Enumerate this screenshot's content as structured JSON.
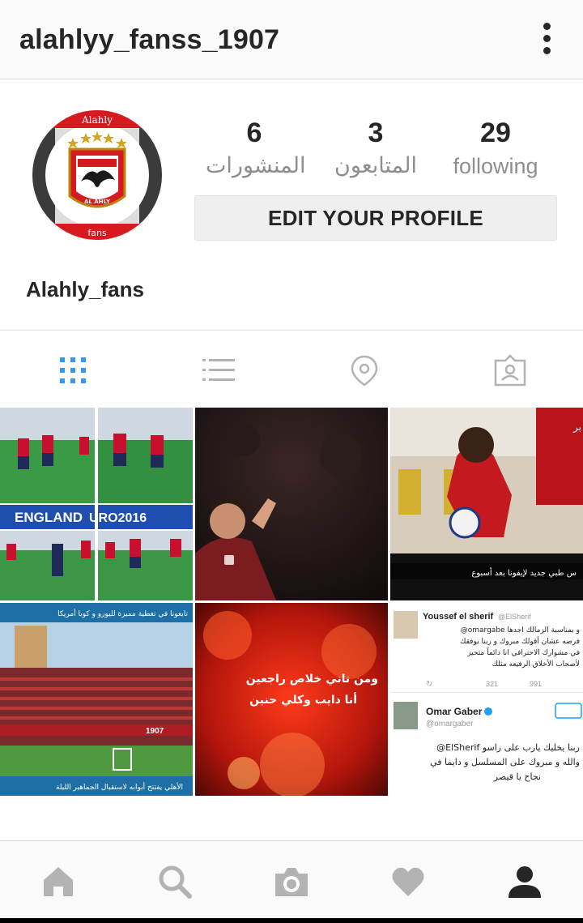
{
  "header": {
    "username": "alahlyy_fanss_1907",
    "menu_icon": "more-vertical-icon"
  },
  "profile": {
    "avatar_badge": {
      "top_text": "Alahly",
      "name_en": "AL AHLY",
      "bottom_text": "fans"
    },
    "stats": [
      {
        "value": "6",
        "label": "المنشورات"
      },
      {
        "value": "3",
        "label": "المتابعون"
      },
      {
        "value": "29",
        "label": "following"
      }
    ],
    "edit_button": "EDIT YOUR PROFILE",
    "display_name": "Alahly_fans"
  },
  "tabs": [
    {
      "icon": "grid-icon",
      "active": true
    },
    {
      "icon": "list-icon",
      "active": false
    },
    {
      "icon": "location-pin-icon",
      "active": false
    },
    {
      "icon": "tagged-person-icon",
      "active": false
    }
  ],
  "posts": {
    "post1": {
      "banner": "ENGLAND",
      "banner2": "URO2016"
    },
    "post3": {
      "caption": "س طبي جديد لإيفونا بعد أسبوع",
      "corner": "بر"
    },
    "post4": {
      "top_caption": "تابعونا في تغطية مميزة لليورو و كوبا أمريكا",
      "bottom_caption": "الأهلي يفتتح أبوابه لاستقبال الجماهير الليلة",
      "stand_text": "1907"
    },
    "post5": {
      "line1": "ومن تاني خلاص راجعين",
      "line2": "أنا دايب وكلي حنين"
    },
    "post6": {
      "tweet1_name": "Youssef el sherif",
      "tweet1_handle": "@ElSherif",
      "tweet1_line1": "@omargabe و بمناسبة الزمالك اجدها",
      "tweet1_line2": "فرصه عشان أقولك مبروك و ربنا يوفقك",
      "tweet1_line3": "في مشوارك الاحترافي انا دائماً متحيز",
      "tweet1_line4": "لأصحاب الأخلاق الرفيعه مثلك",
      "tweet1_retweets": "321",
      "tweet1_likes": "991",
      "tweet2_name": "Omar Gaber",
      "tweet2_handle": "@omargaber",
      "tweet2_line1": "@ElSherif ربنا يخليك يارب على راسو",
      "tweet2_line2": "والله و مبروك على المسلسل و دايما في",
      "tweet2_line3": "نجاح يا قيصر"
    }
  },
  "bottom_nav": [
    {
      "icon": "home-icon"
    },
    {
      "icon": "search-icon"
    },
    {
      "icon": "camera-icon"
    },
    {
      "icon": "heart-icon"
    },
    {
      "icon": "profile-icon",
      "active": true
    }
  ],
  "colors": {
    "accent": "#3897f0",
    "ahly_red": "#d71920",
    "text": "#262626",
    "muted": "#8e8e8e",
    "active_icon": "#262626",
    "inactive_icon": "#b3b3b3"
  }
}
